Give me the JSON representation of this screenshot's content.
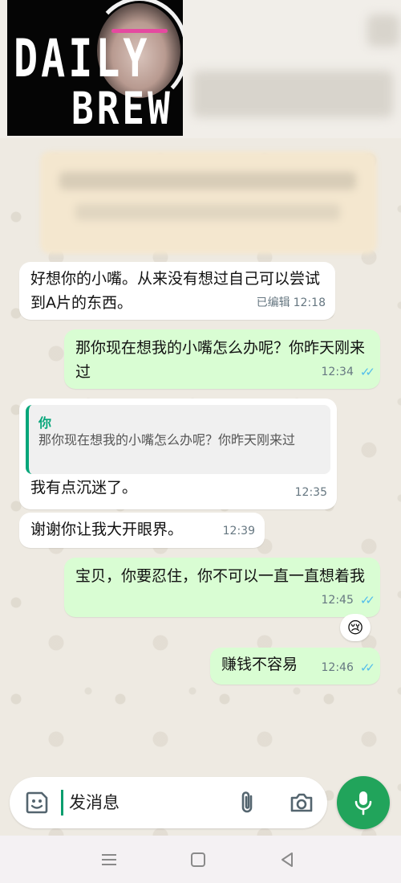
{
  "header": {
    "logo_line1": "DAILY",
    "logo_line2": "BREW"
  },
  "messages": [
    {
      "direction": "in",
      "text": "好想你的小嘴。从来没有想过自己可以尝试到A片的东西。",
      "edited_label": "已编辑",
      "time": "12:18"
    },
    {
      "direction": "out",
      "text": "那你现在想我的小嘴怎么办呢？你昨天刚来过",
      "time": "12:34",
      "read": true
    },
    {
      "direction": "in",
      "quote_author": "你",
      "quote_text": "那你现在想我的小嘴怎么办呢？你昨天刚来过",
      "text": "我有点沉迷了。",
      "time": "12:35"
    },
    {
      "direction": "in",
      "text": "谢谢你让我大开眼界。",
      "time": "12:39"
    },
    {
      "direction": "out",
      "text": "宝贝，你要忍住，你不可以一直一直想着我",
      "time": "12:45",
      "read": true,
      "reaction": "😢"
    },
    {
      "direction": "out",
      "text": "赚钱不容易",
      "time": "12:46",
      "read": true
    }
  ],
  "composer": {
    "placeholder": "发消息"
  },
  "colors": {
    "outgoing_bubble": "#d9fdd3",
    "incoming_bubble": "#ffffff",
    "accent": "#21a45b",
    "read_ticks": "#53bdeb"
  },
  "icons": {
    "sticker": "sticker-icon",
    "attach": "paperclip-icon",
    "camera": "camera-icon",
    "mic": "microphone-icon",
    "nav_menu": "menu-icon",
    "nav_home": "home-icon",
    "nav_back": "back-icon"
  }
}
